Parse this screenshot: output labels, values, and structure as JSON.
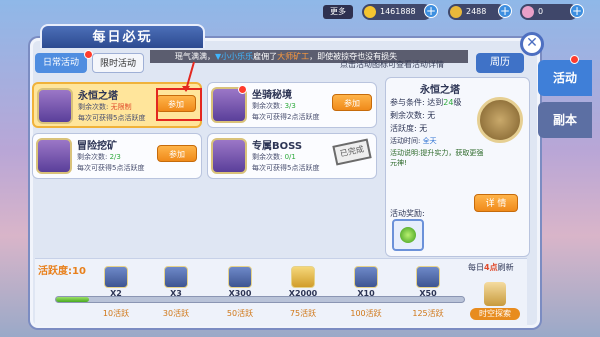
{
  "resources": {
    "more_label": "更多",
    "gold": "1461888",
    "coins": "2488",
    "gems": "0",
    "gold_icon": "gold-star-icon",
    "coin_icon": "coin-icon",
    "gem_icon": "diamond-icon"
  },
  "panel": {
    "title": "每日必玩",
    "close_icon": "close-icon"
  },
  "tabs": {
    "daily": "日常活动",
    "limited": "限时活动"
  },
  "news": {
    "part1": "瑶气满满，",
    "highlight1": "▼小小乐乐",
    "part2": "雇佣了",
    "highlight2": "大师矿工",
    "part3": "，即使被掠夺也没有损失"
  },
  "hint": "点击活动图标可查看活动详情",
  "zhouli": "周历",
  "side_tabs": {
    "active": "活动",
    "inactive": "副本"
  },
  "cards": [
    {
      "name": "永恒之塔",
      "count_prefix": "剩余次数:",
      "count": "无限制",
      "bonus": "每次可获得5点活跃度",
      "button": "参加"
    },
    {
      "name": "坐骑秘境",
      "count_prefix": "剩余次数:",
      "count": "3/3",
      "bonus": "每次可获得2点活跃度",
      "button": "参加"
    },
    {
      "name": "冒险挖矿",
      "count_prefix": "剩余次数:",
      "count": "2/3",
      "bonus": "每次可获得5点活跃度",
      "button": "参加"
    },
    {
      "name": "专属BOSS",
      "count_prefix": "剩余次数:",
      "count": "0/1",
      "bonus": "每次可获得5点活跃度",
      "stamp": "已完成"
    }
  ],
  "detail": {
    "title": "永恒之塔",
    "condition_label": "参与条件:",
    "condition_value": "达到",
    "level": "24",
    "level_suffix": "级",
    "remaining_label": "剩余次数:",
    "remaining_value": "无",
    "activity_label": "活跃度:",
    "activity_value": "无",
    "time_label": "活动时间:",
    "time_value": "全天",
    "desc": "活动说明:提升实力，获取更强元神!",
    "reward_label": "活动奖励:",
    "detail_button": "详  情"
  },
  "progress": {
    "label": "活跃度:10",
    "refresh_prefix": "每日",
    "refresh_hour": "4点",
    "refresh_suffix": "刷新",
    "fill_fraction": 0.08,
    "timespace": "时空探索",
    "milestones": [
      {
        "qty": "X2",
        "label": "10活跃"
      },
      {
        "qty": "X3",
        "label": "30活跃"
      },
      {
        "qty": "X300",
        "label": "50活跃"
      },
      {
        "qty": "X2000",
        "label": "75活跃"
      },
      {
        "qty": "X10",
        "label": "100活跃"
      },
      {
        "qty": "X50",
        "label": "125活跃"
      }
    ]
  },
  "colors": {
    "accent": "#3f7fd8",
    "orange": "#f08a1a",
    "green": "#2eaa3d",
    "red": "#e04a2b"
  }
}
